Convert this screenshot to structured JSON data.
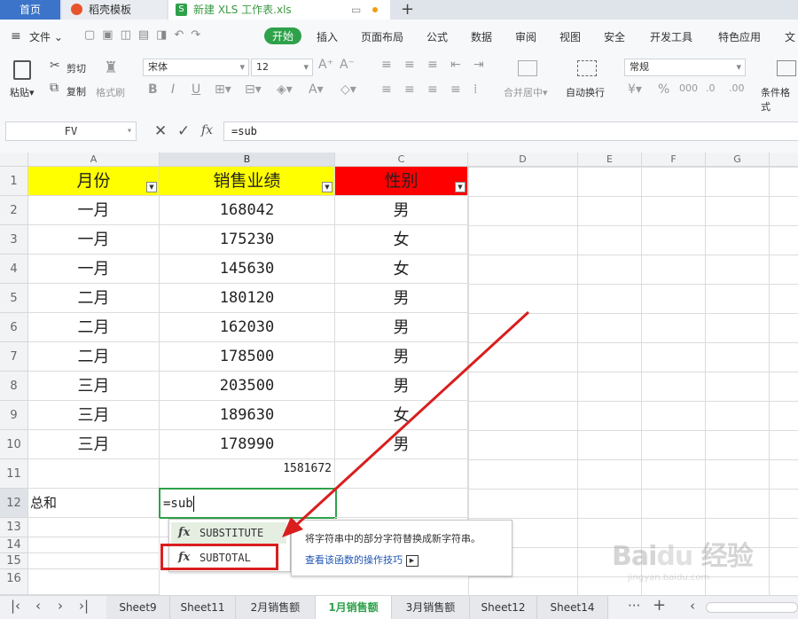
{
  "tabs": {
    "home": "首页",
    "template": "稻壳模板",
    "file": "新建 XLS 工作表.xls",
    "add": "+"
  },
  "menu": {
    "file": "文件",
    "items": [
      "开始",
      "插入",
      "页面布局",
      "公式",
      "数据",
      "审阅",
      "视图",
      "安全",
      "开发工具",
      "特色应用",
      "文"
    ]
  },
  "ribbon": {
    "paste": "粘贴",
    "cut": "剪切",
    "copy": "复制",
    "format_painter": "格式刷",
    "font_name": "宋体",
    "font_size": "12",
    "merge_center": "合并居中",
    "wrap_text": "自动换行",
    "number_format": "常规",
    "conditional_format": "条件格式"
  },
  "formula_bar": {
    "name_box": "FV",
    "fx": "fx",
    "formula": "=sub"
  },
  "columns": [
    "A",
    "B",
    "C",
    "D",
    "E",
    "F",
    "G"
  ],
  "rows": [
    "1",
    "2",
    "3",
    "4",
    "5",
    "6",
    "7",
    "8",
    "9",
    "10",
    "11",
    "12",
    "13",
    "14",
    "15",
    "16"
  ],
  "table": {
    "headers": [
      "月份",
      "销售业绩",
      "性别"
    ],
    "data": [
      [
        "一月",
        "168042",
        "男"
      ],
      [
        "一月",
        "175230",
        "女"
      ],
      [
        "一月",
        "145630",
        "女"
      ],
      [
        "二月",
        "180120",
        "男"
      ],
      [
        "二月",
        "162030",
        "男"
      ],
      [
        "二月",
        "178500",
        "男"
      ],
      [
        "三月",
        "203500",
        "男"
      ],
      [
        "三月",
        "189630",
        "女"
      ],
      [
        "三月",
        "178990",
        "男"
      ]
    ],
    "total_value": "1581672",
    "total_label": "总和",
    "editing_cell": "=sub"
  },
  "autocomplete": {
    "items": [
      "SUBSTITUTE",
      "SUBTOTAL"
    ],
    "fx_glyph": "fx",
    "tooltip_desc": "将字符串中的部分字符替换成新字符串。",
    "tooltip_link": "查看该函数的操作技巧"
  },
  "sheets": [
    "Sheet9",
    "Sheet11",
    "2月销售额",
    "1月销售额",
    "3月销售额",
    "Sheet12",
    "Sheet14"
  ],
  "active_sheet": "1月销售额",
  "colors": {
    "header_yellow": "#ffff00",
    "header_red": "#ff0000",
    "accent_green": "#2fa14a",
    "highlight_red": "#d91e1e"
  },
  "watermark": "Baidu 经验 jingyan.baidu.com"
}
